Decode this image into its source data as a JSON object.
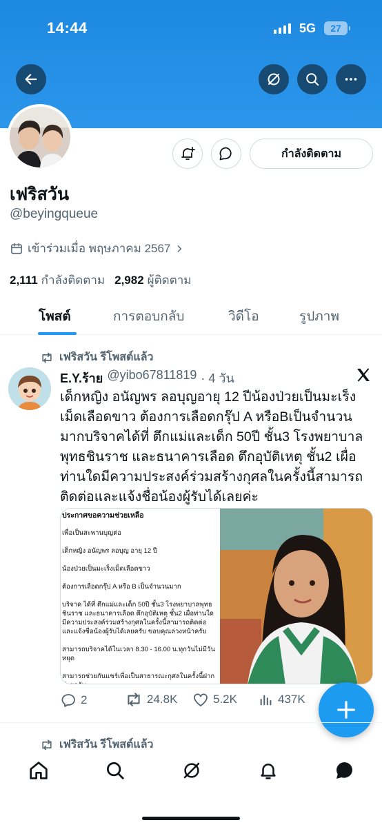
{
  "status_bar": {
    "time": "14:44",
    "network": "5G",
    "battery": "27"
  },
  "profile": {
    "display_name": "เฟริสวัน",
    "handle": "@beyingqueue",
    "joined": "เข้าร่วมเมื่อ พฤษภาคม 2567",
    "following_count": "2,111",
    "following_label": "กำลังติดตาม",
    "followers_count": "2,982",
    "followers_label": "ผู้ติดตาม",
    "follow_button_label": "กำลังติดตาม"
  },
  "tabs": [
    {
      "label": "โพสต์",
      "active": true
    },
    {
      "label": "การตอบกลับ",
      "active": false
    },
    {
      "label": "วิดีโอ",
      "active": false
    },
    {
      "label": "รูปภาพ",
      "active": false
    }
  ],
  "post": {
    "repost_label": "เฟริสวัน รีโพสต์แล้ว",
    "author_name": "E.Y.ร้าย",
    "author_handle": "@yibo67811819",
    "time": "· 4 วัน",
    "text": "เด็กหญิง อนัญพร ลอบุญอายุ 12 ปีน้องป่วยเป็นมะเร็งเม็ดเลือดขาว ต้องการเลือดกรุ๊ป A หรือBเป็นจำนวนมากบริจาคได้ที่ ตึกแม่และเด็ก 50ปี ชั้น3 โรงพยาบาลพุทธชินราช และธนาคารเลือด ตึกอุบัติเหตุ ชั้น2 เผื่อท่านใดมีความประสงค์ร่วมสร้างกุศลในครั้งนี้สามารถติดต่อและแจ้งชื่อน้องผู้รับได้เลยค่ะ",
    "notice": {
      "title": "ประกาศขอความช่วยเหลือ",
      "lines": [
        "เพื่อเป็นสะพานบุญต่อ",
        "เด็กหญิง อนัญพร ลอบุญ อายุ 12 ปี",
        "น้องป่วยเป็นมะเร็งเม็ดเลือดขาว",
        "ต้องการเลือดกรุ๊ป A หรือ B เป็นจำนวนมาก",
        "บริจาค ได้ที่ ตึกแม่และเด็ก 50ปี ชั้น3 โรงพยาบาลพุทธชินราช และธนาคารเลือด ตึกอุบัติเหตุ ชั้น2 เผื่อท่านใดมีความประสงค์ร่วมสร้างกุศลในครั้งนี้สามารถติดต่อและแจ้งชื่อน้องผู้รับได้เลยครับ ขอบคุณล่วงหน้าครับ",
        "สามารถบริจาคได้ในเวลา 8.30 - 16.00 น.ทุกวันไม่มีวันหยุด",
        "สามารถช่วยกันแชร์เพื่อเป็นสาธารณะกุศลในครั้งนี้ฝากด้วยครับ"
      ]
    },
    "replies": "2",
    "reposts": "24.8K",
    "likes": "5.2K",
    "views": "437K"
  },
  "next_repost_label": "เฟริสวัน รีโพสต์แล้ว",
  "colors": {
    "banner": "#1d88e0",
    "accent": "#1d9bf0",
    "text": "#0f1419",
    "muted": "#536471"
  },
  "icons": [
    "back-arrow-icon",
    "grok-icon",
    "search-icon",
    "more-icon",
    "bell-plus-icon",
    "message-icon",
    "calendar-icon",
    "chevron-right-icon",
    "repost-icon",
    "x-logo-icon",
    "reply-icon",
    "like-icon",
    "views-icon",
    "plus-icon",
    "home-icon",
    "notifications-icon",
    "messages-icon"
  ]
}
